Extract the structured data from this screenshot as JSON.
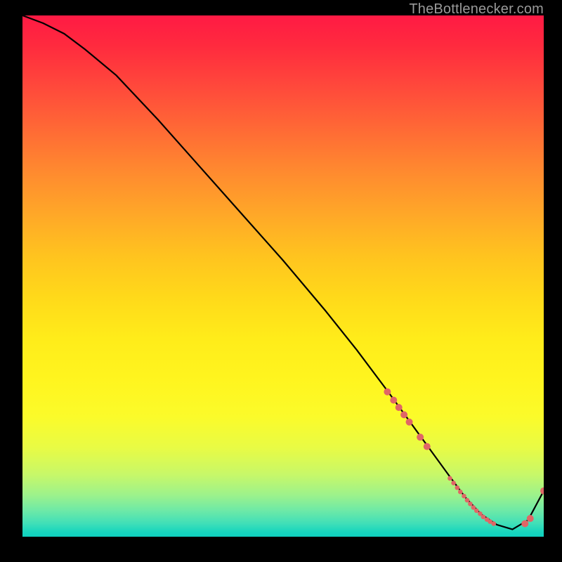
{
  "watermark": "TheBottlenecker.com",
  "chart_data": {
    "type": "line",
    "title": "",
    "xlabel": "",
    "ylabel": "",
    "xlim": [
      0,
      100
    ],
    "ylim": [
      0,
      100
    ],
    "series": [
      {
        "name": "curve",
        "x": [
          0,
          4,
          8,
          12,
          18,
          26,
          34,
          42,
          50,
          58,
          64,
          70,
          74,
          78,
          82,
          85,
          88,
          91,
          94,
          97,
          100
        ],
        "y": [
          100,
          98.5,
          96.5,
          93.5,
          88.5,
          80,
          71,
          62,
          53,
          43.5,
          36,
          28,
          22.5,
          17,
          11.5,
          7.5,
          4.3,
          2.3,
          1.4,
          3.2,
          8.8
        ]
      }
    ],
    "markers": [
      {
        "name": "marker",
        "x": 70.0,
        "y": 27.8,
        "r": 5.0
      },
      {
        "name": "marker",
        "x": 71.2,
        "y": 26.2,
        "r": 5.0
      },
      {
        "name": "marker",
        "x": 72.2,
        "y": 24.8,
        "r": 5.0
      },
      {
        "name": "marker",
        "x": 73.2,
        "y": 23.4,
        "r": 5.0
      },
      {
        "name": "marker",
        "x": 74.2,
        "y": 22.0,
        "r": 5.0
      },
      {
        "name": "marker",
        "x": 76.3,
        "y": 19.1,
        "r": 5.0
      },
      {
        "name": "marker",
        "x": 77.6,
        "y": 17.3,
        "r": 5.0
      },
      {
        "name": "marker",
        "x": 82.0,
        "y": 11.2,
        "r": 3.3
      },
      {
        "name": "marker",
        "x": 82.7,
        "y": 10.3,
        "r": 3.3
      },
      {
        "name": "marker",
        "x": 83.4,
        "y": 9.4,
        "r": 3.3
      },
      {
        "name": "marker",
        "x": 84.0,
        "y": 8.6,
        "r": 3.3
      },
      {
        "name": "marker",
        "x": 84.7,
        "y": 7.8,
        "r": 3.3
      },
      {
        "name": "marker",
        "x": 85.3,
        "y": 7.0,
        "r": 3.3
      },
      {
        "name": "marker",
        "x": 85.9,
        "y": 6.3,
        "r": 3.3
      },
      {
        "name": "marker",
        "x": 86.5,
        "y": 5.6,
        "r": 3.3
      },
      {
        "name": "marker",
        "x": 87.1,
        "y": 5.0,
        "r": 3.3
      },
      {
        "name": "marker",
        "x": 87.8,
        "y": 4.4,
        "r": 3.3
      },
      {
        "name": "marker",
        "x": 88.4,
        "y": 3.8,
        "r": 3.3
      },
      {
        "name": "marker",
        "x": 89.1,
        "y": 3.3,
        "r": 3.3
      },
      {
        "name": "marker",
        "x": 89.7,
        "y": 2.9,
        "r": 3.3
      },
      {
        "name": "marker",
        "x": 90.4,
        "y": 2.5,
        "r": 3.3
      },
      {
        "name": "marker",
        "x": 96.4,
        "y": 2.5,
        "r": 5.0
      },
      {
        "name": "marker",
        "x": 97.4,
        "y": 3.5,
        "r": 5.0
      },
      {
        "name": "marker",
        "x": 100.0,
        "y": 8.8,
        "r": 5.0
      }
    ],
    "colors": {
      "curve": "#000000",
      "marker": "#e06666"
    }
  }
}
